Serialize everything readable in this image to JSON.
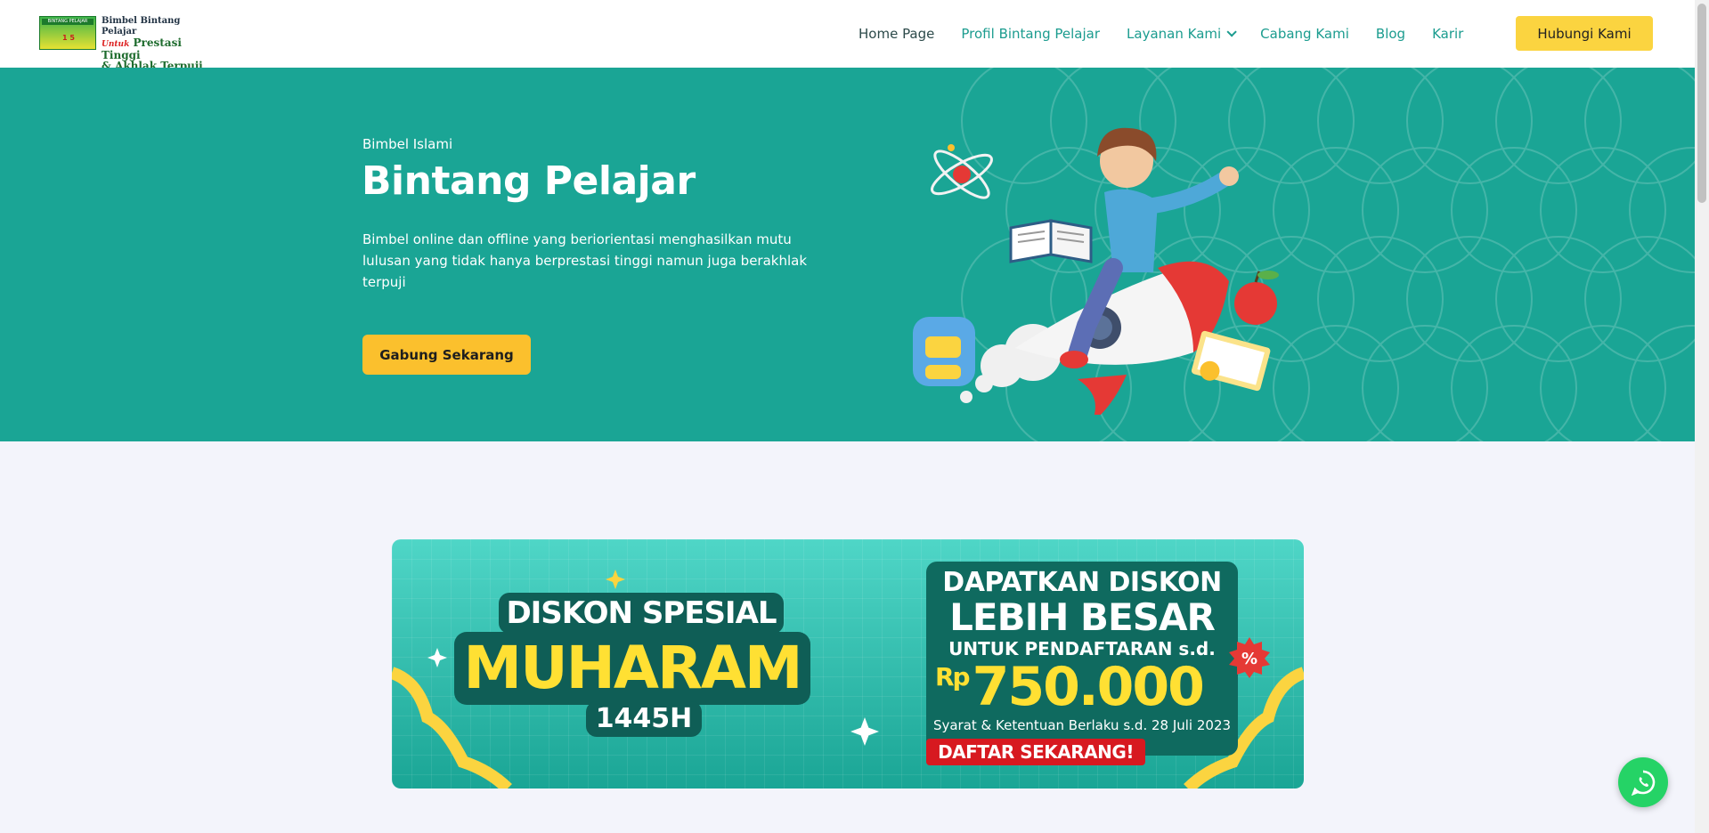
{
  "logo": {
    "badge_top": "BINTANG PELAJAR",
    "badge_mid": "1 5",
    "line1": "Bimbel Bintang Pelajar",
    "line2_script": "Untuk",
    "line2": "Prestasi Tinggi",
    "line3": "& Akhlak Terpuji"
  },
  "nav": {
    "items": [
      {
        "label": "Home Page"
      },
      {
        "label": "Profil Bintang Pelajar"
      },
      {
        "label": "Layanan Kami"
      },
      {
        "label": "Cabang Kami"
      },
      {
        "label": "Blog"
      },
      {
        "label": "Karir"
      }
    ],
    "cta": "Hubungi Kami"
  },
  "hero": {
    "eyebrow": "Bimbel Islami",
    "title": "Bintang Pelajar",
    "description": "Bimbel online dan offline yang beriorientasi menghasilkan mutu lulusan yang tidak hanya berprestasi tinggi namun juga berakhlak terpuji",
    "button": "Gabung Sekarang"
  },
  "promo": {
    "line1": "DISKON SPESIAL",
    "line2": "MUHARAM",
    "line3": "1445H",
    "box_line1": "DAPATKAN DISKON",
    "box_line2": "LEBIH BESAR",
    "box_line3": "UNTUK PENDAFTARAN s.d.",
    "currency": "Rp",
    "amount": "750.000",
    "terms": "Syarat & Ketentuan Berlaku s.d. 28 Juli 2023",
    "cta": "DAFTAR SEKARANG!",
    "badge": "%"
  },
  "colors": {
    "teal": "#1aa595",
    "yellow": "#fbc02d",
    "nav_text": "#1b9c8f",
    "whatsapp": "#25d366"
  },
  "icons": {
    "whatsapp": "whatsapp-icon",
    "dropdown": "chevron-down-icon"
  }
}
